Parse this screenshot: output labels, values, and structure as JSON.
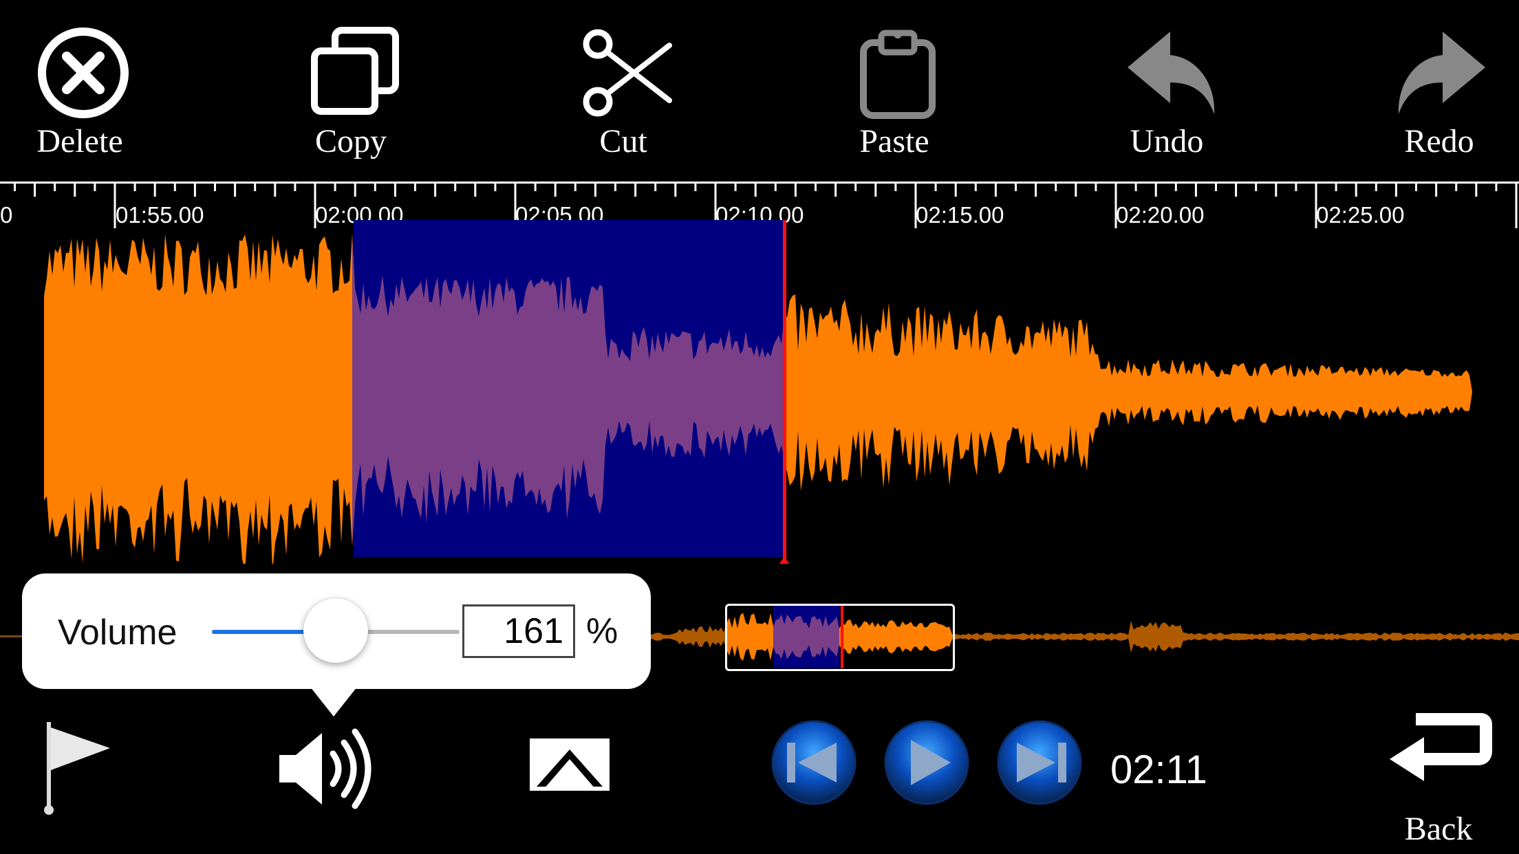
{
  "toolbar": {
    "delete_label": "Delete",
    "copy_label": "Copy",
    "cut_label": "Cut",
    "paste_label": "Paste",
    "undo_label": "Undo",
    "redo_label": "Redo"
  },
  "timeline": {
    "labels": [
      "0",
      "01:55.00",
      "02:00.00",
      "02:05.00",
      "02:10.00",
      "02:15.00",
      "02:20.00",
      "02:25.00"
    ]
  },
  "volume": {
    "label": "Volume",
    "value": "161",
    "unit": "%",
    "slider_fraction": 0.5
  },
  "playback": {
    "time": "02:11"
  },
  "bottom": {
    "back_label": "Back"
  },
  "colors": {
    "waveform": "#ff8000",
    "selection": "#000080",
    "playhead": "#ff1010",
    "slider_fill": "#1a73e8",
    "disabled_icon": "#888888"
  },
  "icons": {
    "delete": "x-circle-icon",
    "copy": "copy-icon",
    "cut": "scissors-icon",
    "paste": "clipboard-icon",
    "undo": "undo-arrow-icon",
    "redo": "redo-arrow-icon",
    "marker": "flag-icon",
    "volume": "speaker-icon",
    "airplay": "airplay-icon",
    "skip_back": "skip-back-icon",
    "play": "play-icon",
    "skip_forward": "skip-forward-icon",
    "back": "return-arrow-icon"
  }
}
